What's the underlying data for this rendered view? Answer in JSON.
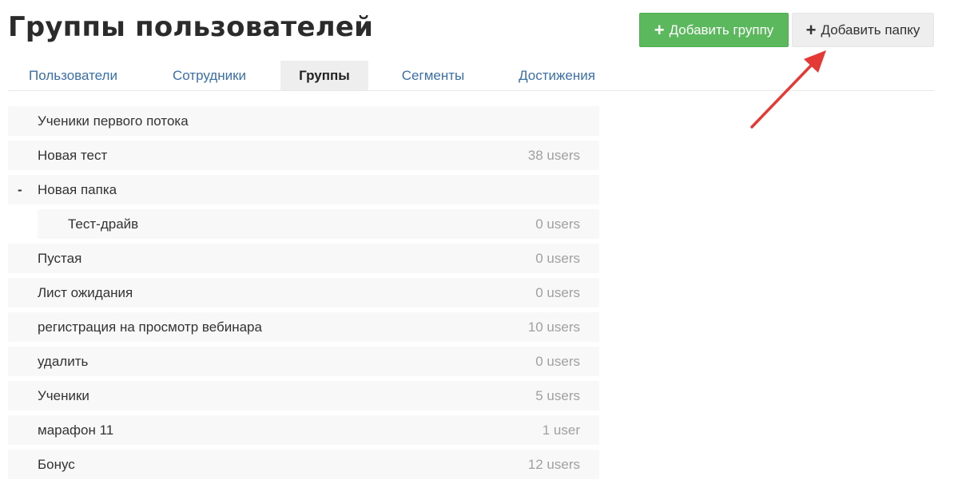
{
  "header": {
    "title": "Группы пользователей",
    "add_group_label": "Добавить группу",
    "add_folder_label": "Добавить папку",
    "plus": "+"
  },
  "tabs": [
    {
      "label": "Пользователи",
      "active": false
    },
    {
      "label": "Сотрудники",
      "active": false
    },
    {
      "label": "Группы",
      "active": true
    },
    {
      "label": "Сегменты",
      "active": false
    },
    {
      "label": "Достижения",
      "active": false
    }
  ],
  "groups": [
    {
      "name": "Ученики первого потока",
      "count": ""
    },
    {
      "name": "Новая тест",
      "count": "38 users"
    },
    {
      "name": "Новая папка",
      "count": "",
      "folder": true,
      "toggle": "-"
    },
    {
      "name": "Тест-драйв",
      "count": "0 users",
      "nested": true
    },
    {
      "name": "Пустая",
      "count": "0 users"
    },
    {
      "name": "Лист ожидания",
      "count": "0 users"
    },
    {
      "name": "регистрация на просмотр вебинара",
      "count": "10 users"
    },
    {
      "name": "удалить",
      "count": "0 users"
    },
    {
      "name": "Ученики",
      "count": "5 users"
    },
    {
      "name": "марафон 11",
      "count": "1 user"
    },
    {
      "name": "Бонус",
      "count": "12 users"
    }
  ],
  "colors": {
    "accent_green": "#5cb85c",
    "link_blue": "#3a6fa8",
    "annotation_red": "#e53935"
  }
}
